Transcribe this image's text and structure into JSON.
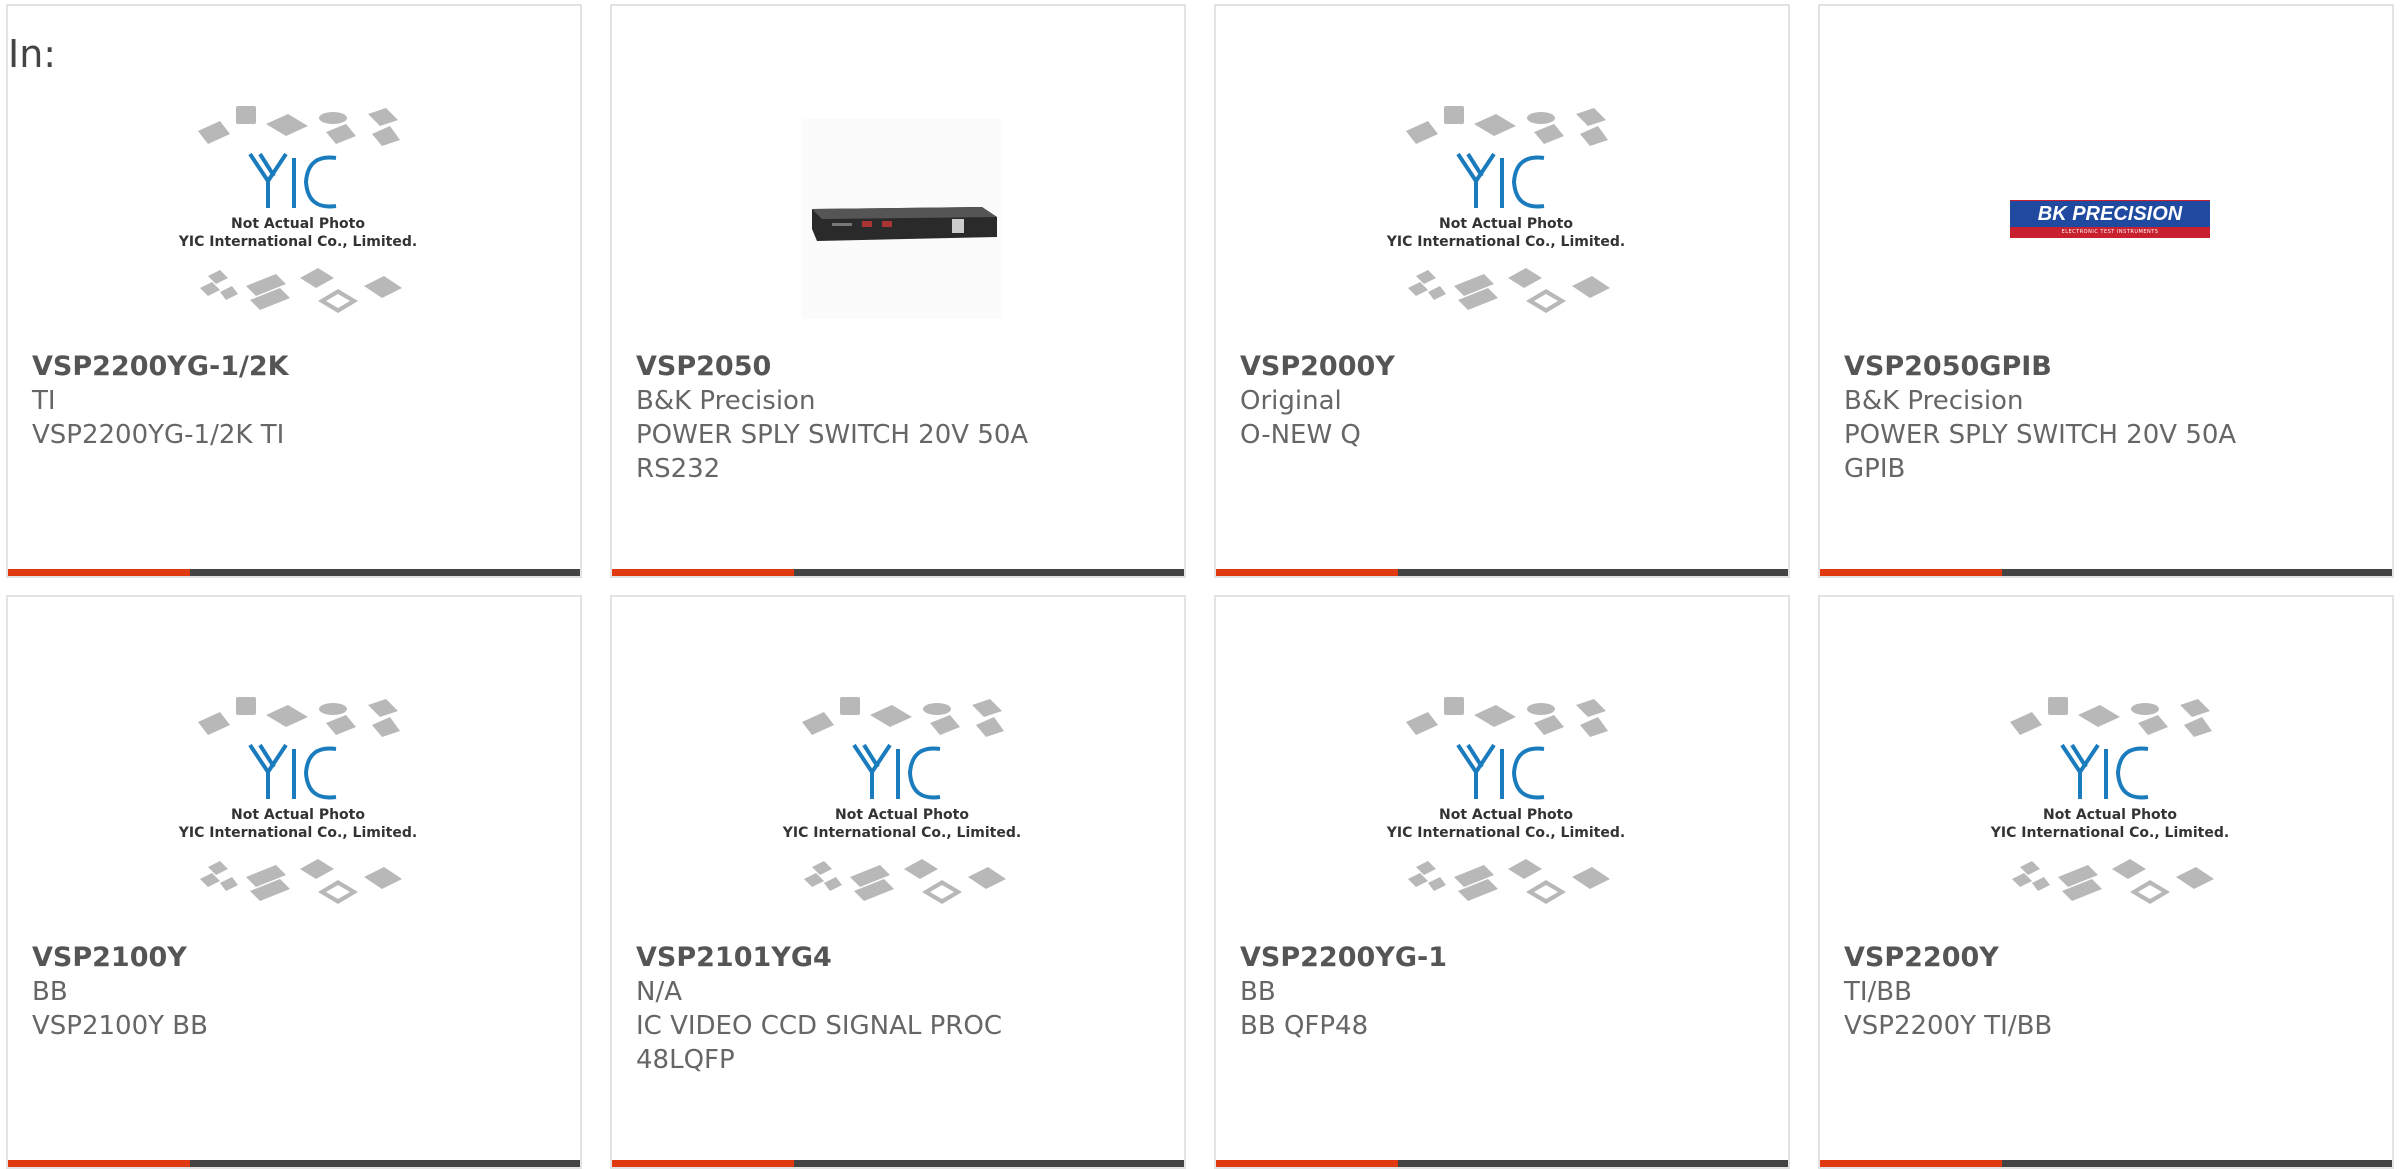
{
  "filter_label": "In:",
  "placeholder": {
    "caption_line1": "Not Actual Photo",
    "caption_line2": "YIC International Co., Limited.",
    "logo_text": "YIC"
  },
  "brand_logo": {
    "text": "BK PRECISION",
    "subtext": "ELECTRONIC TEST INSTRUMENTS"
  },
  "colors": {
    "accent": "#e0380f",
    "bar": "#444444",
    "logo_blue": "#1a7bbd",
    "card_border": "#e3e3e3"
  },
  "products": [
    {
      "part": "VSP2200YG-1/2K",
      "maker": "TI",
      "desc": [
        "VSP2200YG-1/2K TI"
      ],
      "image": "placeholder"
    },
    {
      "part": "VSP2050",
      "maker": "B&K Precision",
      "desc": [
        "POWER SPLY SWITCH 20V 50A",
        "RS232"
      ],
      "image": "power-supply"
    },
    {
      "part": "VSP2000Y",
      "maker": "Original",
      "desc": [
        "O-NEW Q"
      ],
      "image": "placeholder"
    },
    {
      "part": "VSP2050GPIB",
      "maker": "B&K Precision",
      "desc": [
        "POWER SPLY SWITCH 20V 50A",
        "GPIB"
      ],
      "image": "bk-logo"
    },
    {
      "part": "VSP2100Y",
      "maker": "BB",
      "desc": [
        "VSP2100Y BB"
      ],
      "image": "placeholder"
    },
    {
      "part": "VSP2101YG4",
      "maker": "N/A",
      "desc": [
        "IC VIDEO CCD SIGNAL PROC",
        "48LQFP"
      ],
      "image": "placeholder"
    },
    {
      "part": "VSP2200YG-1",
      "maker": "BB",
      "desc": [
        "BB QFP48"
      ],
      "image": "placeholder"
    },
    {
      "part": "VSP2200Y",
      "maker": "TI/BB",
      "desc": [
        "VSP2200Y TI/BB"
      ],
      "image": "placeholder"
    }
  ]
}
